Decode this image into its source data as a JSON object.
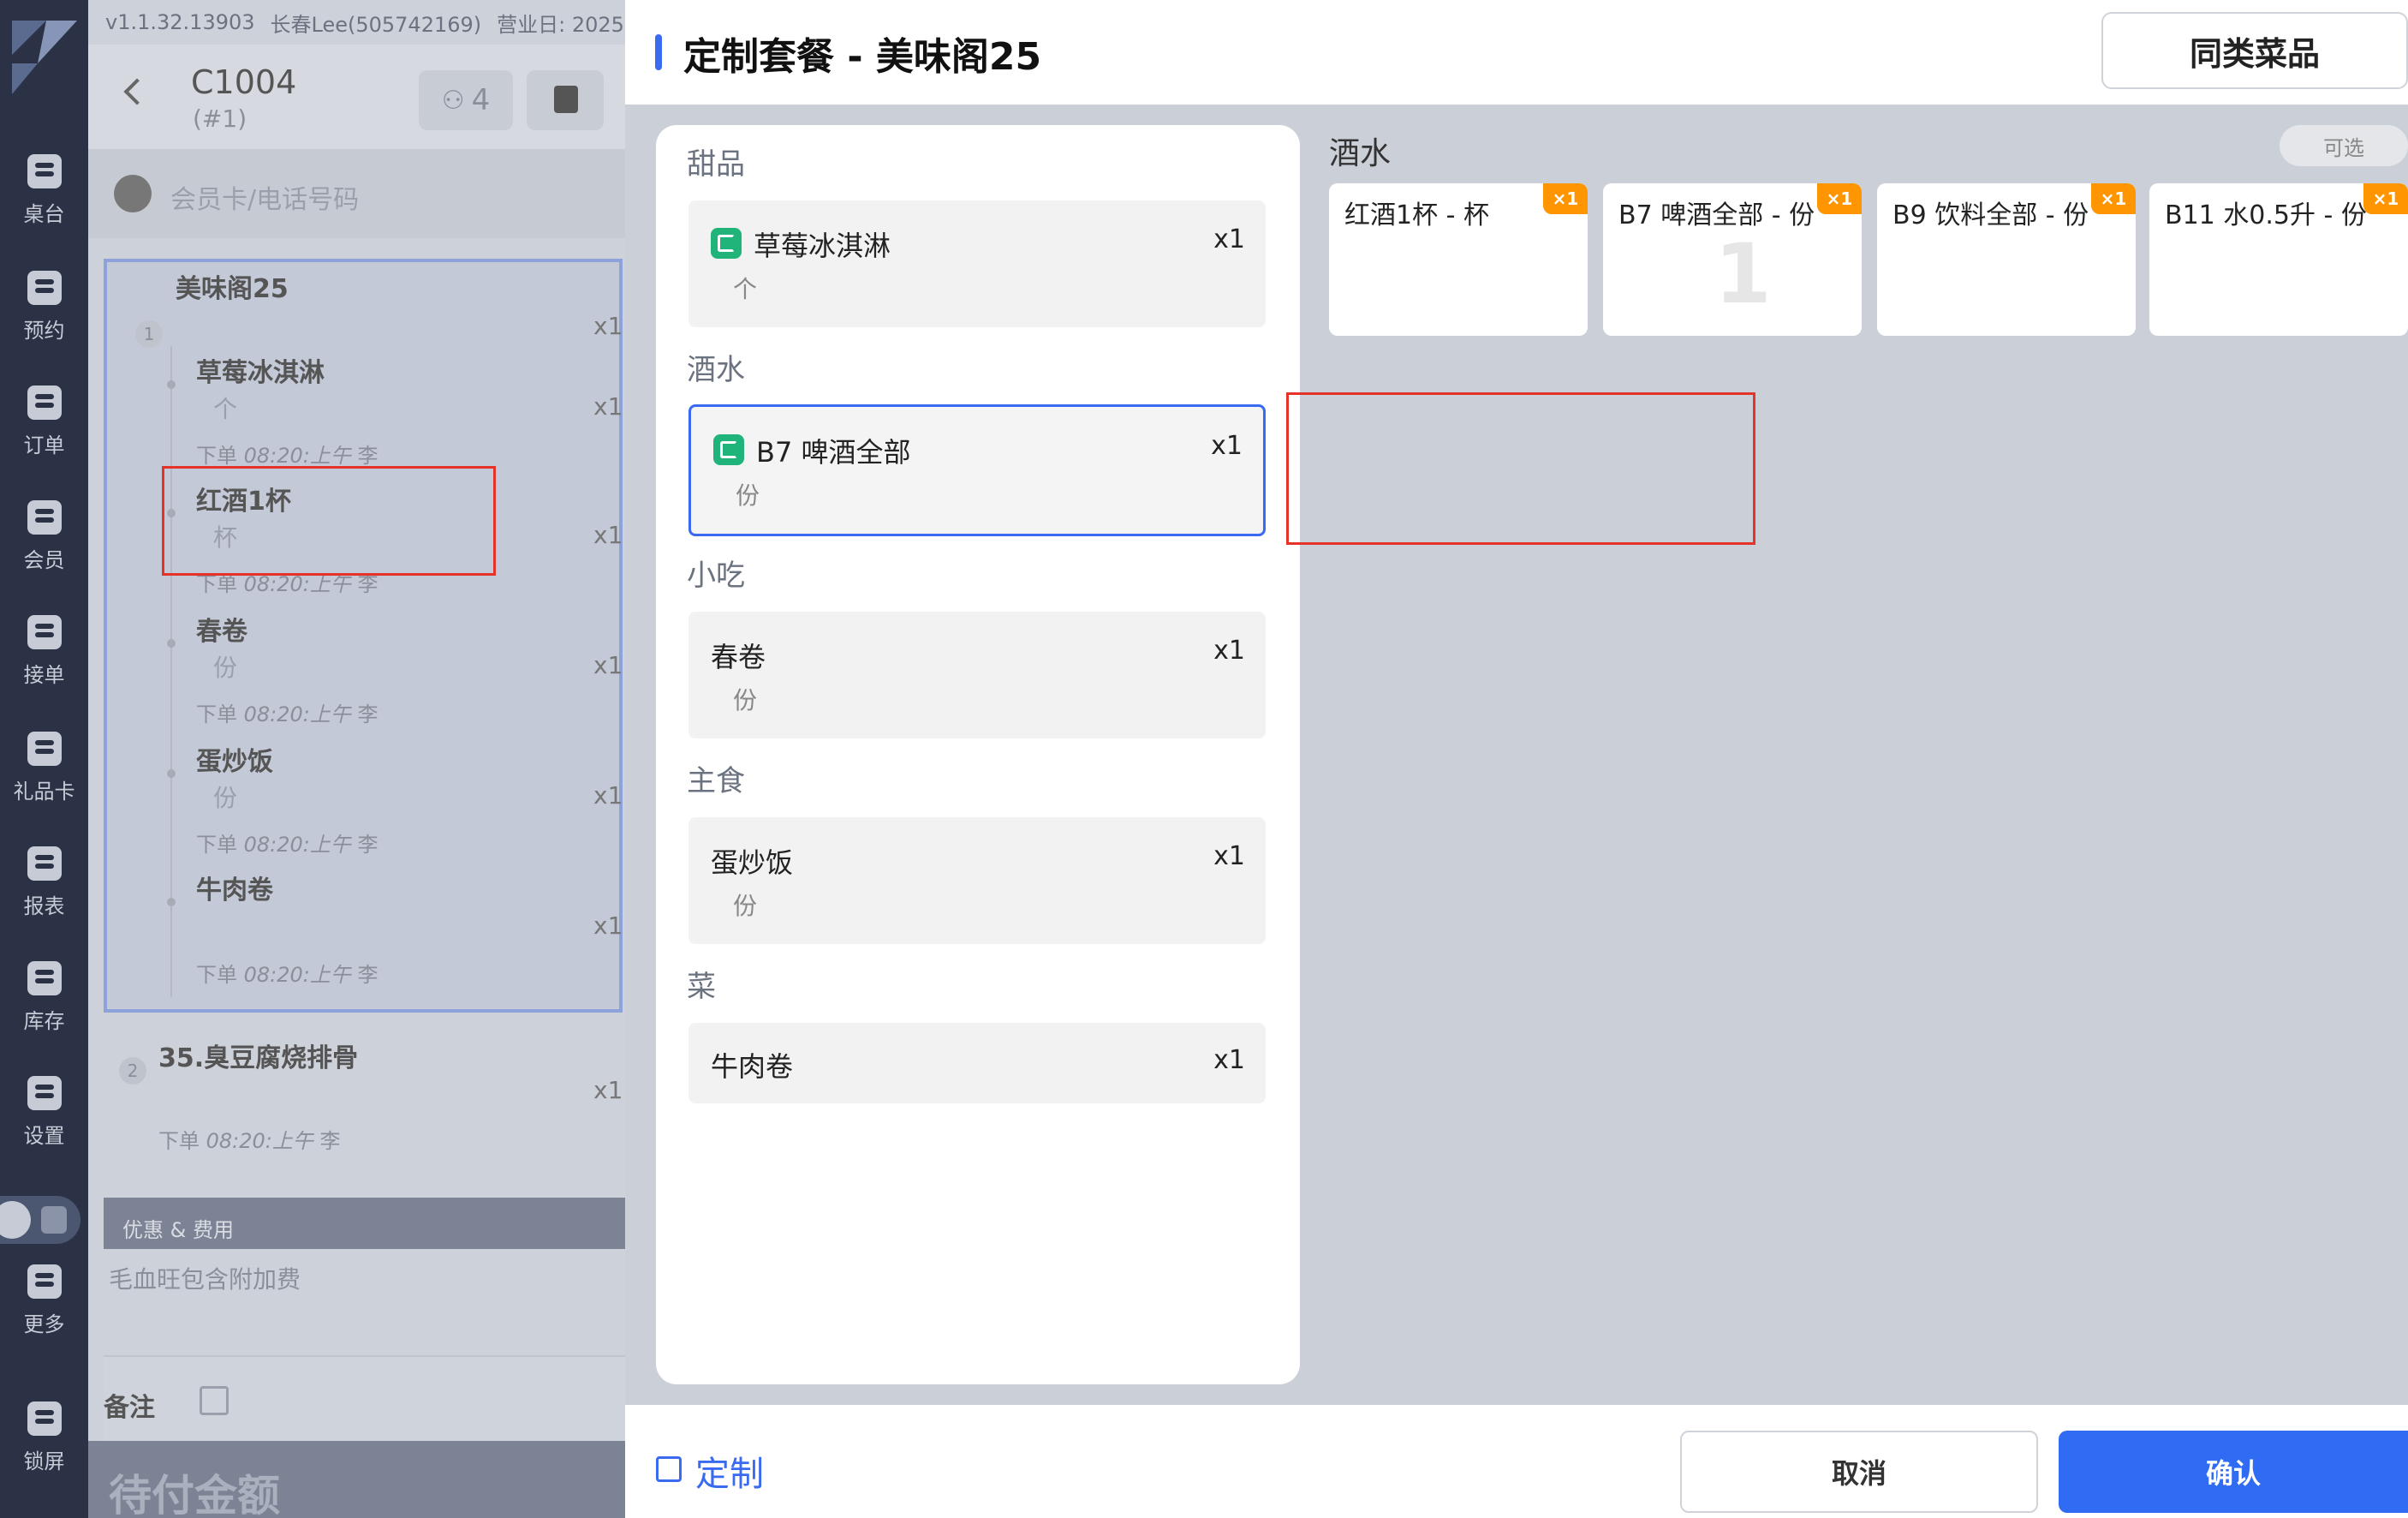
{
  "rail": {
    "items": [
      {
        "label": "桌台",
        "icon": "table-icon"
      },
      {
        "label": "预约",
        "icon": "reservation-icon"
      },
      {
        "label": "订单",
        "icon": "order-icon"
      },
      {
        "label": "会员",
        "icon": "member-icon"
      },
      {
        "label": "接单",
        "icon": "accept-order-icon"
      },
      {
        "label": "礼品卡",
        "icon": "gift-card-icon"
      },
      {
        "label": "报表",
        "icon": "report-icon"
      },
      {
        "label": "库存",
        "icon": "inventory-icon"
      },
      {
        "label": "设置",
        "icon": "settings-icon"
      },
      {
        "label": "更多",
        "icon": "more-icon"
      },
      {
        "label": "锁屏",
        "icon": "lock-icon"
      }
    ]
  },
  "topbar": {
    "version": "v1.1.32.13903",
    "user": "长春Lee(505742169)",
    "business_day": "营业日: 2025"
  },
  "order": {
    "table": "C1004",
    "sub": "(#1)",
    "guests": "4",
    "member_placeholder": "会员卡/电话号码",
    "combo": {
      "index": "1",
      "name": "美味阁25",
      "qty": "x1",
      "items": [
        {
          "name": "草莓冰淇淋",
          "unit": "个",
          "qty": "x1",
          "meta_label": "下单",
          "meta_time": "08:20:上午",
          "meta_user": "李"
        },
        {
          "name": "红酒1杯",
          "unit": "杯",
          "qty": "x1",
          "meta_label": "下单",
          "meta_time": "08:20:上午",
          "meta_user": "李"
        },
        {
          "name": "春卷",
          "unit": "份",
          "qty": "x1",
          "meta_label": "下单",
          "meta_time": "08:20:上午",
          "meta_user": "李"
        },
        {
          "name": "蛋炒饭",
          "unit": "份",
          "qty": "x1",
          "meta_label": "下单",
          "meta_time": "08:20:上午",
          "meta_user": "李"
        },
        {
          "name": "牛肉卷",
          "unit": "",
          "qty": "x1",
          "meta_label": "下单",
          "meta_time": "08:20:上午",
          "meta_user": "李"
        }
      ]
    },
    "second": {
      "index": "2",
      "name": "35.臭豆腐烧排骨",
      "qty": "x1",
      "meta_label": "下单",
      "meta_time": "08:20:上午",
      "meta_user": "李"
    },
    "fees_header": "优惠 & 费用",
    "fees_item": "毛血旺包含附加费",
    "notes_label": "备注",
    "pay_label": "待付金额"
  },
  "modal": {
    "title": "定制套餐 - 美味阁25",
    "similar_button": "同类菜品",
    "categories": [
      {
        "title": "甜品",
        "item": "草莓冰淇淋",
        "unit": "个",
        "qty": "x1",
        "icon": true,
        "selected": false
      },
      {
        "title": "酒水",
        "item": "B7 啤酒全部",
        "unit": "份",
        "qty": "x1",
        "icon": true,
        "selected": true
      },
      {
        "title": "小吃",
        "item": "春卷",
        "unit": "份",
        "qty": "x1",
        "icon": false,
        "selected": false
      },
      {
        "title": "主食",
        "item": "蛋炒饭",
        "unit": "份",
        "qty": "x1",
        "icon": false,
        "selected": false
      },
      {
        "title": "菜",
        "item": "牛肉卷",
        "unit": "",
        "qty": "x1",
        "icon": false,
        "selected": false
      }
    ],
    "options_title": "酒水",
    "optional_badge": "可选",
    "options": [
      {
        "name": "红酒1杯 - 杯",
        "badge": "×1",
        "count": ""
      },
      {
        "name": "B7 啤酒全部 - 份",
        "badge": "×1",
        "count": "1"
      },
      {
        "name": "B9 饮料全部 - 份",
        "badge": "×1",
        "count": ""
      },
      {
        "name": "B11 水0.5升 - 份",
        "badge": "×1",
        "count": ""
      }
    ],
    "customize_label": "定制",
    "cancel_button": "取消",
    "confirm_button": "确认"
  },
  "colors": {
    "accent": "#2f6bf3",
    "badge": "#ff9500",
    "highlight": "#e5332a",
    "item_icon": "#20b47a"
  }
}
